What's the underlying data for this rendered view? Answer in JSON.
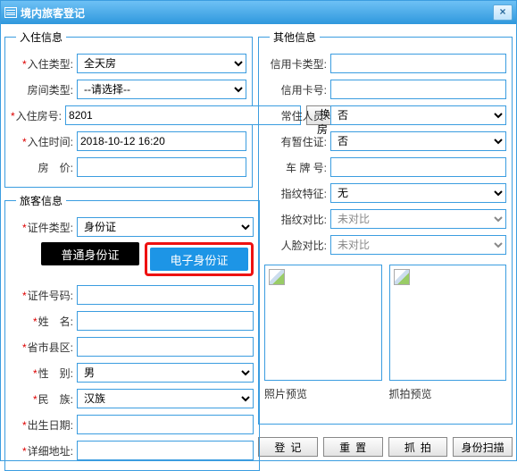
{
  "window": {
    "title": "境内旅客登记",
    "close": "×"
  },
  "checkin": {
    "legend": "入住信息",
    "type_label": "入住类型:",
    "type_value": "全天房",
    "roomtype_label": "房间类型:",
    "roomtype_value": "--请选择--",
    "roomno_label": "入住房号:",
    "roomno_value": "8201",
    "changeroom_btn": "换房",
    "time_label": "入住时间:",
    "time_value": "2018-10-12 16:20",
    "price_label": "房　价:",
    "price_value": ""
  },
  "guest": {
    "legend": "旅客信息",
    "idtype_label": "证件类型:",
    "idtype_value": "身份证",
    "tab_normal": "普通身份证",
    "tab_eid": "电子身份证",
    "idno_label": "证件号码:",
    "idno_value": "",
    "name_label": "姓　名:",
    "name_value": "",
    "region_label": "省市县区:",
    "region_value": "",
    "gender_label": "性　别:",
    "gender_value": "男",
    "ethnic_label": "民　族:",
    "ethnic_value": "汉族",
    "birth_label": "出生日期:",
    "birth_value": "",
    "addr_label": "详细地址:",
    "addr_value": ""
  },
  "other": {
    "legend": "其他信息",
    "cardtype_label": "信用卡类型:",
    "cardtype_value": "",
    "cardno_label": "信用卡号:",
    "cardno_value": "",
    "resident_label": "常住人员:",
    "resident_value": "否",
    "tempcert_label": "有暂住证:",
    "tempcert_value": "否",
    "plate_label": "车 牌 号:",
    "plate_value": "",
    "fp_label": "指纹特征:",
    "fp_value": "无",
    "fpcmp_label": "指纹对比:",
    "fpcmp_value": "未对比",
    "facecmp_label": "人脸对比:",
    "facecmp_value": "未对比",
    "photo1_label": "照片预览",
    "photo2_label": "抓拍预览"
  },
  "buttons": {
    "register": "登记",
    "reset": "重置",
    "capture": "抓拍",
    "scan": "身份扫描"
  }
}
